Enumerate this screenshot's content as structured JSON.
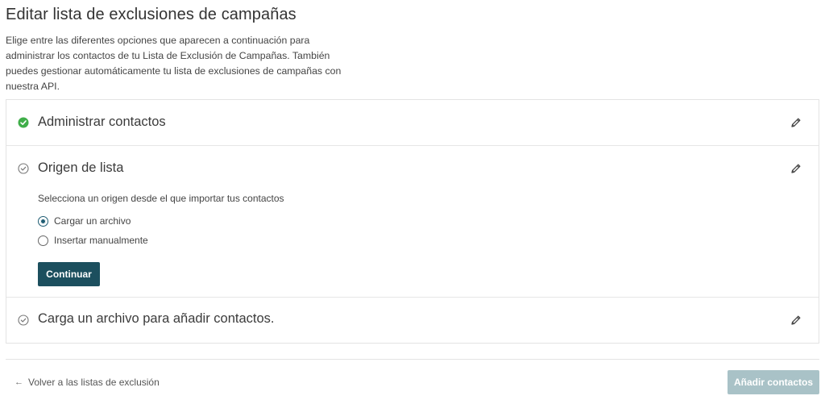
{
  "page": {
    "title": "Editar lista de exclusiones de campañas",
    "intro": "Elige entre las diferentes opciones que aparecen a continuación para administrar los contactos de tu Lista de Exclusión de Campañas. También puedes gestionar automáticamente tu lista de exclusiones de campañas con nuestra API."
  },
  "steps": [
    {
      "title": "Administrar contactos",
      "status": "complete",
      "status_icon": "check-circle-filled-icon",
      "status_color": "#3fae49",
      "edit_icon": "pencil-icon"
    },
    {
      "title": "Origen de lista",
      "status": "active",
      "status_icon": "check-circle-outline-icon",
      "edit_icon": "pencil-icon"
    },
    {
      "title": "Carga un archivo para añadir contactos.",
      "status": "pending",
      "status_icon": "check-circle-outline-icon",
      "edit_icon": "pencil-icon"
    }
  ],
  "origin": {
    "prompt": "Selecciona un origen desde el que importar tus contactos",
    "options": [
      {
        "label": "Cargar un archivo",
        "selected": true
      },
      {
        "label": "Insertar manualmente",
        "selected": false
      }
    ],
    "continue_label": "Continuar"
  },
  "footer": {
    "back_label": "Volver a las listas de exclusión",
    "back_icon": "arrow-left-icon",
    "add_label": "Añadir contactos",
    "add_disabled": true
  },
  "colors": {
    "primary": "#1c4f5e",
    "primary_disabled": "#a9c2c7",
    "success": "#3fae49"
  }
}
